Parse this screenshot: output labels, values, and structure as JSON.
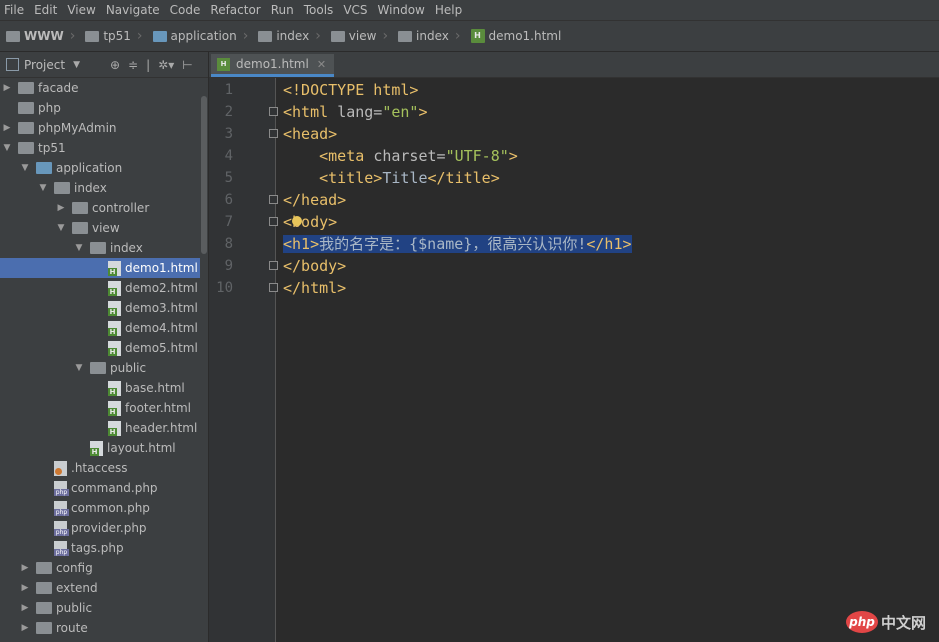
{
  "menu": [
    "File",
    "Edit",
    "View",
    "Navigate",
    "Code",
    "Refactor",
    "Run",
    "Tools",
    "VCS",
    "Window",
    "Help"
  ],
  "breadcrumbs": [
    "WWW",
    "tp51",
    "application",
    "index",
    "view",
    "index",
    "demo1.html"
  ],
  "project_panel": {
    "title": "Project"
  },
  "tree": [
    {
      "label": "facade",
      "type": "folder",
      "depth": 0,
      "arrow": "right"
    },
    {
      "label": "php",
      "type": "folder",
      "depth": 0,
      "arrow": ""
    },
    {
      "label": "phpMyAdmin",
      "type": "folder",
      "depth": 0,
      "arrow": "right"
    },
    {
      "label": "tp51",
      "type": "folder",
      "depth": 0,
      "arrow": "down"
    },
    {
      "label": "application",
      "type": "folder-blue",
      "depth": 1,
      "arrow": "down"
    },
    {
      "label": "index",
      "type": "folder",
      "depth": 2,
      "arrow": "down"
    },
    {
      "label": "controller",
      "type": "folder",
      "depth": 3,
      "arrow": "right"
    },
    {
      "label": "view",
      "type": "folder",
      "depth": 3,
      "arrow": "down"
    },
    {
      "label": "index",
      "type": "folder",
      "depth": 4,
      "arrow": "down"
    },
    {
      "label": "demo1.html",
      "type": "html",
      "depth": 5,
      "arrow": "",
      "selected": true
    },
    {
      "label": "demo2.html",
      "type": "html",
      "depth": 5,
      "arrow": ""
    },
    {
      "label": "demo3.html",
      "type": "html",
      "depth": 5,
      "arrow": ""
    },
    {
      "label": "demo4.html",
      "type": "html",
      "depth": 5,
      "arrow": ""
    },
    {
      "label": "demo5.html",
      "type": "html",
      "depth": 5,
      "arrow": ""
    },
    {
      "label": "public",
      "type": "folder",
      "depth": 4,
      "arrow": "down"
    },
    {
      "label": "base.html",
      "type": "html",
      "depth": 5,
      "arrow": ""
    },
    {
      "label": "footer.html",
      "type": "html",
      "depth": 5,
      "arrow": ""
    },
    {
      "label": "header.html",
      "type": "html",
      "depth": 5,
      "arrow": ""
    },
    {
      "label": "layout.html",
      "type": "html",
      "depth": 4,
      "arrow": ""
    },
    {
      "label": ".htaccess",
      "type": "ht",
      "depth": 2,
      "arrow": ""
    },
    {
      "label": "command.php",
      "type": "php",
      "depth": 2,
      "arrow": ""
    },
    {
      "label": "common.php",
      "type": "php",
      "depth": 2,
      "arrow": ""
    },
    {
      "label": "provider.php",
      "type": "php",
      "depth": 2,
      "arrow": ""
    },
    {
      "label": "tags.php",
      "type": "php",
      "depth": 2,
      "arrow": ""
    },
    {
      "label": "config",
      "type": "folder",
      "depth": 1,
      "arrow": "right"
    },
    {
      "label": "extend",
      "type": "folder",
      "depth": 1,
      "arrow": "right"
    },
    {
      "label": "public",
      "type": "folder",
      "depth": 1,
      "arrow": "right"
    },
    {
      "label": "route",
      "type": "folder",
      "depth": 1,
      "arrow": "right"
    }
  ],
  "tab": {
    "label": "demo1.html"
  },
  "editor": {
    "lines": [
      [
        {
          "c": "tag",
          "t": "<!DOCTYPE html>"
        }
      ],
      [
        {
          "c": "tag",
          "t": "<html "
        },
        {
          "c": "attr",
          "t": "lang="
        },
        {
          "c": "str",
          "t": "\"en\""
        },
        {
          "c": "tag",
          "t": ">"
        }
      ],
      [
        {
          "c": "tag",
          "t": "<head>"
        }
      ],
      [
        {
          "c": "txt",
          "t": "    "
        },
        {
          "c": "tag",
          "t": "<meta "
        },
        {
          "c": "attr",
          "t": "charset="
        },
        {
          "c": "str",
          "t": "\"UTF-8\""
        },
        {
          "c": "tag",
          "t": ">"
        }
      ],
      [
        {
          "c": "txt",
          "t": "    "
        },
        {
          "c": "tag",
          "t": "<title>"
        },
        {
          "c": "txt",
          "t": "Title"
        },
        {
          "c": "tag",
          "t": "</title>"
        }
      ],
      [
        {
          "c": "tag",
          "t": "</head>"
        }
      ],
      [
        {
          "c": "tag",
          "t": "<body>"
        }
      ],
      [
        {
          "c": "tag",
          "t": "<h1>"
        },
        {
          "c": "txt",
          "t": "我的名字是：{$name}，很高兴认识你!"
        },
        {
          "c": "tag",
          "t": "</h1>"
        }
      ],
      [
        {
          "c": "tag",
          "t": "</body>"
        }
      ],
      [
        {
          "c": "tag",
          "t": "</html>"
        }
      ]
    ],
    "highlight_line": 8
  },
  "watermark": {
    "logo": "php",
    "text": "中文网"
  }
}
